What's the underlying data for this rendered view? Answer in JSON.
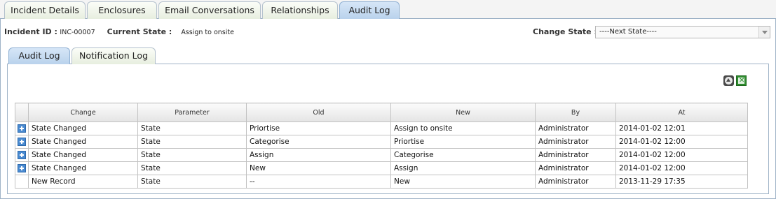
{
  "tabs": [
    "Incident Details",
    "Enclosures",
    "Email Conversations",
    "Relationships",
    "Audit Log"
  ],
  "active_tab": "Audit Log",
  "incident": {
    "id_label": "Incident ID :",
    "id_value": "INC-00007",
    "state_label": "Current State :",
    "state_value": "Assign to onsite"
  },
  "change_state": {
    "label": "Change State :",
    "selected": "----Next State----"
  },
  "sub_tabs": [
    "Audit Log",
    "Notification Log"
  ],
  "active_sub_tab": "Audit Log",
  "toolbar_icons": [
    "collapse-up-icon",
    "excel-export-icon"
  ],
  "table": {
    "columns": [
      "Change",
      "Parameter",
      "Old",
      "New",
      "By",
      "At"
    ],
    "rows": [
      {
        "expandable": true,
        "cells": [
          "State Changed",
          "State",
          "Priortise",
          "Assign to onsite",
          "Administrator",
          "2014-01-02 12:01"
        ]
      },
      {
        "expandable": true,
        "cells": [
          "State Changed",
          "State",
          "Categorise",
          "Priortise",
          "Administrator",
          "2014-01-02 12:00"
        ]
      },
      {
        "expandable": true,
        "cells": [
          "State Changed",
          "State",
          "Assign",
          "Categorise",
          "Administrator",
          "2014-01-02 12:00"
        ]
      },
      {
        "expandable": true,
        "cells": [
          "State Changed",
          "State",
          "New",
          "Assign",
          "Administrator",
          "2014-01-02 12:00"
        ]
      },
      {
        "expandable": false,
        "cells": [
          "New Record",
          "State",
          "--",
          "New",
          "Administrator",
          "2013-11-29 17:35"
        ]
      }
    ]
  },
  "colors": {
    "active_tab_bg": "#c6dcf2",
    "inactive_tab_bg": "#eef3e8",
    "border": "#9fb3c7",
    "expand_icon": "#4a8ad0",
    "excel_green": "#2e8b2e"
  }
}
